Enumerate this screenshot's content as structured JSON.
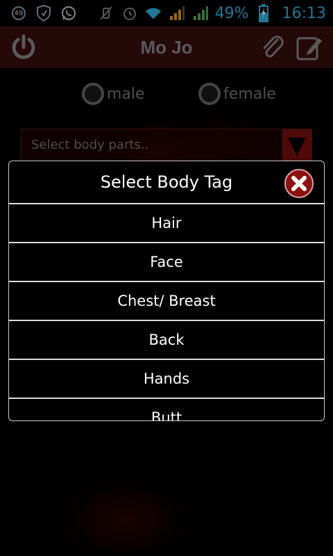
{
  "status_bar": {
    "notification_count": "49",
    "battery_percent": "49%",
    "time": "16:13",
    "icons": [
      "notification-count-icon",
      "shield-icon",
      "whatsapp-icon",
      "mute-icon",
      "alarm-icon",
      "wifi-icon",
      "signal-orange-icon",
      "signal-green-icon",
      "battery-charging-icon"
    ]
  },
  "app_bar": {
    "title": "Mo Jo",
    "left_icon": "power-icon",
    "right_icons": [
      "paperclip-icon",
      "edit-icon"
    ]
  },
  "gender": {
    "options": [
      "male",
      "female"
    ]
  },
  "body_parts_dropdown": {
    "placeholder": "Select body parts.."
  },
  "dialog": {
    "title": "Select Body Tag",
    "items": [
      "Hair",
      "Face",
      "Chest/ Breast",
      "Back",
      "Hands",
      "Butt"
    ]
  },
  "colors": {
    "accent_blue": "#33b5e5",
    "appbar_bg": "#3a0d0d",
    "close_button_red": "#8b1010"
  }
}
